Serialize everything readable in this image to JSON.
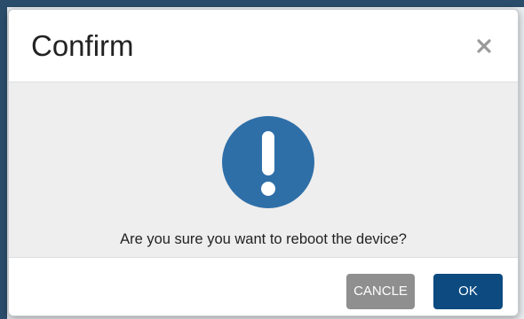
{
  "dialog": {
    "title": "Confirm",
    "close_icon": "close-icon",
    "alert_icon": "exclamation-circle-icon",
    "message": "Are you sure you want to reboot the device?",
    "cancel_label": "CANCLE",
    "ok_label": "OK"
  },
  "colors": {
    "alert_icon": "#2f6fa8",
    "ok_button": "#0c4a80",
    "cancel_button": "#8f8f8f",
    "body_background": "#eeeeee"
  }
}
